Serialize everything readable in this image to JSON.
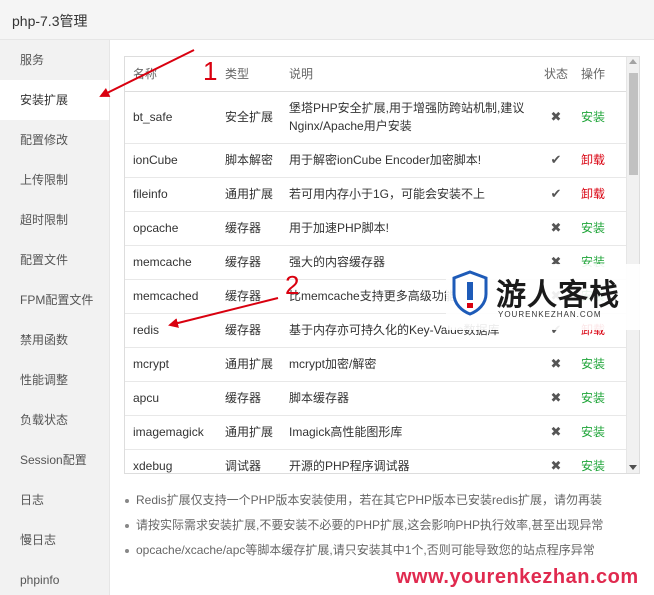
{
  "window": {
    "title": "php-7.3管理"
  },
  "sidebar": {
    "items": [
      {
        "label": "服务"
      },
      {
        "label": "安装扩展",
        "active": true
      },
      {
        "label": "配置修改"
      },
      {
        "label": "上传限制"
      },
      {
        "label": "超时限制"
      },
      {
        "label": "配置文件"
      },
      {
        "label": "FPM配置文件"
      },
      {
        "label": "禁用函数"
      },
      {
        "label": "性能调整"
      },
      {
        "label": "负载状态"
      },
      {
        "label": "Session配置"
      },
      {
        "label": "日志"
      },
      {
        "label": "慢日志"
      },
      {
        "label": "phpinfo"
      }
    ]
  },
  "table": {
    "headers": {
      "name": "名称",
      "type": "类型",
      "desc": "说明",
      "status": "状态",
      "op": "操作"
    },
    "rows": [
      {
        "name": "bt_safe",
        "type": "安全扩展",
        "desc_line1": "堡塔PHP安全扩展,用于增强防跨站机制,建议",
        "desc_line2": "Nginx/Apache用户安装",
        "status": "✖",
        "status_icon": "x-icon",
        "op": "安装"
      },
      {
        "name": "ionCube",
        "type": "脚本解密",
        "desc_line1": "用于解密ionCube Encoder加密脚本!",
        "desc_line2": "",
        "status": "✔",
        "status_icon": "check-icon",
        "op": "卸载"
      },
      {
        "name": "fileinfo",
        "type": "通用扩展",
        "desc_line1": "若可用内存小于1G，可能会安装不上",
        "desc_line2": "",
        "status": "✔",
        "status_icon": "check-icon",
        "op": "卸载"
      },
      {
        "name": "opcache",
        "type": "缓存器",
        "desc_line1": "用于加速PHP脚本!",
        "desc_line2": "",
        "status": "✖",
        "status_icon": "x-icon",
        "op": "安装"
      },
      {
        "name": "memcache",
        "type": "缓存器",
        "desc_line1": "强大的内容缓存器",
        "desc_line2": "",
        "status": "✖",
        "status_icon": "x-icon",
        "op": "安装"
      },
      {
        "name": "memcached",
        "type": "缓存器",
        "desc_line1": "比memcache支持更多高级功能",
        "desc_line2": "",
        "status": "✖",
        "status_icon": "x-icon",
        "op": "安装"
      },
      {
        "name": "redis",
        "type": "缓存器",
        "desc_line1": "基于内存亦可持久化的Key-Value数据库",
        "desc_line2": "",
        "status": "✔",
        "status_icon": "check-icon",
        "op": "卸载"
      },
      {
        "name": "mcrypt",
        "type": "通用扩展",
        "desc_line1": "mcrypt加密/解密",
        "desc_line2": "",
        "status": "✖",
        "status_icon": "x-icon",
        "op": "安装"
      },
      {
        "name": "apcu",
        "type": "缓存器",
        "desc_line1": "脚本缓存器",
        "desc_line2": "",
        "status": "✖",
        "status_icon": "x-icon",
        "op": "安装"
      },
      {
        "name": "imagemagick",
        "type": "通用扩展",
        "desc_line1": "Imagick高性能图形库",
        "desc_line2": "",
        "status": "✖",
        "status_icon": "x-icon",
        "op": "安装"
      },
      {
        "name": "xdebug",
        "type": "调试器",
        "desc_line1": "开源的PHP程序调试器",
        "desc_line2": "",
        "status": "✖",
        "status_icon": "x-icon",
        "op": "安装"
      }
    ]
  },
  "notes": [
    "Redis扩展仅支持一个PHP版本安装使用，若在其它PHP版本已安装redis扩展，请勿再装",
    "请按实际需求安装扩展,不要安装不必要的PHP扩展,这会影响PHP执行效率,甚至出现异常",
    "opcache/xcache/apc等脚本缓存扩展,请只安装其中1个,否则可能导致您的站点程序异常"
  ],
  "annotations": {
    "num1": "1",
    "num2": "2"
  },
  "watermark": {
    "cn": "游人客栈",
    "en": "YOURENKEZHAN.COM",
    "url": "www.yourenkezhan.com"
  },
  "colors": {
    "install": "#20a53a",
    "uninstall": "#d9000f",
    "annotation": "#d9000f",
    "watermark_url": "#e02a4f"
  }
}
